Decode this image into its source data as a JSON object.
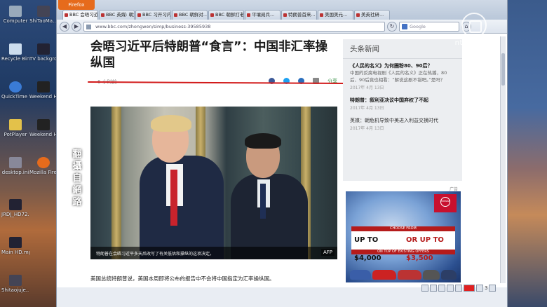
{
  "desktop": {
    "icons": [
      {
        "label": "Computer",
        "icon": "computer-icon"
      },
      {
        "label": "ShiTaoMa...",
        "icon": "file-icon"
      },
      {
        "label": "Recycle Bin",
        "icon": "recycle-bin-icon"
      },
      {
        "label": "TV backgrou...",
        "icon": "file-icon"
      },
      {
        "label": "QuickTime Player",
        "icon": "quicktime-icon"
      },
      {
        "label": "Weekend HD.mp4",
        "icon": "video-icon"
      },
      {
        "label": "PotPlayer",
        "icon": "potplayer-icon"
      },
      {
        "label": "Weekend HD.mp4",
        "icon": "video-icon"
      },
      {
        "label": "desktop.ini",
        "icon": "file-icon"
      },
      {
        "label": "Mozilla Firefox",
        "icon": "firefox-icon"
      },
      {
        "label": "JRDJ_HD72...",
        "icon": "video-icon"
      },
      {
        "label": "Main HD.mp4",
        "icon": "video-icon"
      },
      {
        "label": "Shitaojuje...",
        "icon": "file-icon"
      }
    ]
  },
  "browser": {
    "app_button": "Firefox",
    "tabs": [
      "BBC 会晤习近...",
      "BBC 英媒: 朝危...",
      "BBC 习开习内...",
      "BBC 朝鲜对...",
      "BBC 朝鲜打老...",
      "平壤阅兵...",
      "特朗普首来...",
      "美国美元...",
      "美英社研..."
    ],
    "url": "www.bbc.com/zhongwen/simp/business-39585938",
    "search_placeholder": "Google"
  },
  "article": {
    "headline": "会晤习近平后特朗普“食言”：中国非汇率操纵国",
    "date": "6 小时前",
    "share_label": "分享",
    "photo_caption": "特朗普在会晤习近平多天后改写了有关低估和操纵的这项决定。",
    "photo_credit": "AFP",
    "first_paragraph": "美国总统特朗普说，美国本周即将公布的报告中不会将中国指定为汇率操纵国。"
  },
  "sidebar": {
    "title": "头条新闻",
    "items": [
      {
        "headline": "《人民的名义》为何圈粉80、90后？",
        "desc": "中国的反腐电视剧《人民的名义》正在热播，80后、90后竟也相看：“解说这剧不错吧。”是吗？",
        "date": "2017年 4月 13日"
      },
      {
        "headline": "特朗普：叙利亚决议中国弃权了不起",
        "desc": "",
        "date": "2017年 4月 13日"
      },
      {
        "headline": "英媒：朝危机导致中美进入利益交换时代",
        "desc": "",
        "date": "2017年 4月 13日"
      }
    ]
  },
  "ad": {
    "label": "广告",
    "brand": "NISSAN",
    "banner_top": "CHOOSE FROM",
    "offer_a": "UP TO $4,000",
    "offer_b": "OR UP TO $3,500",
    "banner_bottom": "ON TOP OF EXISTING OFFERS"
  },
  "toolbar": {
    "page_num": "3"
  },
  "overlay": {
    "vertical_label": [
      "翻",
      "攝",
      "自",
      "網",
      "路"
    ],
    "channel_logo": "ntdtv.com"
  }
}
